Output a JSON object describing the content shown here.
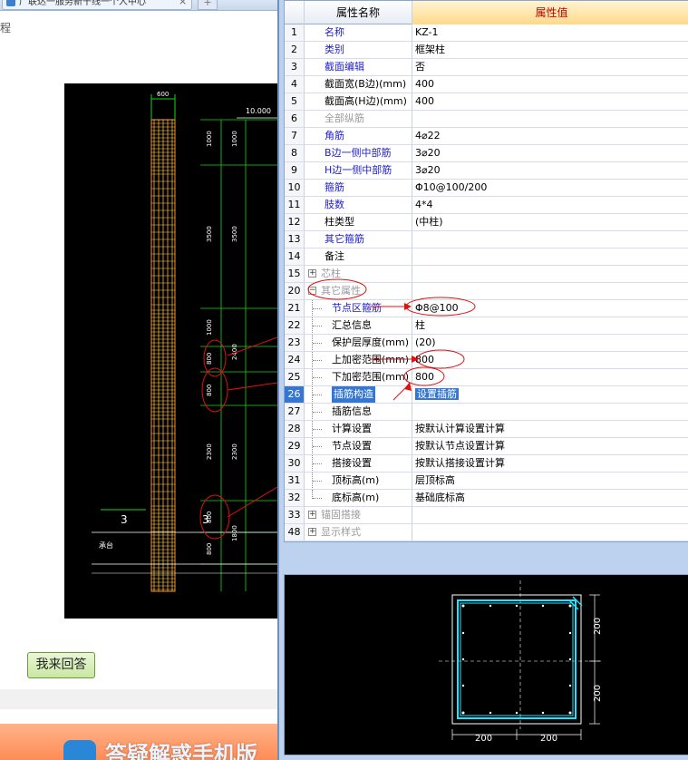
{
  "browser": {
    "tab_title": "广联达一服务新干线一个人中心",
    "tab_close": "×",
    "new_tab": "+",
    "side_char": "程"
  },
  "cad_elevation": {
    "labels": {
      "top_width": "600",
      "elevation_top": "10.000",
      "segs_left": [
        "1000",
        "3500",
        "1000",
        "800",
        "800",
        "2300",
        "800",
        "800"
      ],
      "segs_right": [
        "1000",
        "3500",
        "2400",
        "2300",
        "1800"
      ],
      "section_left": "3",
      "section_right": "3",
      "cheng_tai": "承台"
    }
  },
  "answer_button": {
    "label": "我来回答"
  },
  "promo": {
    "text": "答疑解惑手机版"
  },
  "property_grid": {
    "header": {
      "name": "属性名称",
      "value": "属性值"
    },
    "rows": [
      {
        "num": "1",
        "name": "名称",
        "value": "KZ-1",
        "color": "blue"
      },
      {
        "num": "2",
        "name": "类别",
        "value": "框架柱",
        "color": "blue"
      },
      {
        "num": "3",
        "name": "截面编辑",
        "value": "否",
        "color": "blue"
      },
      {
        "num": "4",
        "name": "截面宽(B边)(mm)",
        "value": "400",
        "color": "black"
      },
      {
        "num": "5",
        "name": "截面高(H边)(mm)",
        "value": "400",
        "color": "black"
      },
      {
        "num": "6",
        "name": "全部纵筋",
        "value": "",
        "color": "gray"
      },
      {
        "num": "7",
        "name": "角筋",
        "value": "4⌀22",
        "color": "blue"
      },
      {
        "num": "8",
        "name": "B边一侧中部筋",
        "value": "3⌀20",
        "color": "blue"
      },
      {
        "num": "9",
        "name": "H边一侧中部筋",
        "value": "3⌀20",
        "color": "blue"
      },
      {
        "num": "10",
        "name": "箍筋",
        "value": "Φ10@100/200",
        "color": "blue"
      },
      {
        "num": "11",
        "name": "肢数",
        "value": "4*4",
        "color": "blue"
      },
      {
        "num": "12",
        "name": "柱类型",
        "value": "(中柱)",
        "color": "black"
      },
      {
        "num": "13",
        "name": "其它箍筋",
        "value": "",
        "color": "blue"
      },
      {
        "num": "14",
        "name": "备注",
        "value": "",
        "color": "black"
      },
      {
        "num": "15",
        "name": "芯柱",
        "value": "",
        "color": "gray",
        "expander": "+"
      },
      {
        "num": "20",
        "name": "其它属性",
        "value": "",
        "color": "gray",
        "expander": "−"
      },
      {
        "num": "21",
        "name": "节点区箍筋",
        "value": "Φ8@100",
        "color": "blue",
        "child": true
      },
      {
        "num": "22",
        "name": "汇总信息",
        "value": "柱",
        "color": "black",
        "child": true
      },
      {
        "num": "23",
        "name": "保护层厚度(mm)",
        "value": "(20)",
        "color": "black",
        "child": true
      },
      {
        "num": "24",
        "name": "上加密范围(mm)",
        "value": "800",
        "color": "black",
        "child": true
      },
      {
        "num": "25",
        "name": "下加密范围(mm)",
        "value": "800",
        "color": "black",
        "child": true
      },
      {
        "num": "26",
        "name": "插筋构造",
        "value": "设置插筋",
        "color": "black",
        "child": true,
        "selected": true
      },
      {
        "num": "27",
        "name": "插筋信息",
        "value": "",
        "color": "black",
        "child": true
      },
      {
        "num": "28",
        "name": "计算设置",
        "value": "按默认计算设置计算",
        "color": "black",
        "child": true
      },
      {
        "num": "29",
        "name": "节点设置",
        "value": "按默认节点设置计算",
        "color": "black",
        "child": true
      },
      {
        "num": "30",
        "name": "搭接设置",
        "value": "按默认搭接设置计算",
        "color": "black",
        "child": true
      },
      {
        "num": "31",
        "name": "顶标高(m)",
        "value": "层顶标高",
        "color": "black",
        "child": true
      },
      {
        "num": "32",
        "name": "底标高(m)",
        "value": "基础底标高",
        "color": "black",
        "child": true,
        "last": true
      },
      {
        "num": "33",
        "name": "锚固搭接",
        "value": "",
        "color": "gray",
        "expander": "+"
      },
      {
        "num": "48",
        "name": "显示样式",
        "value": "",
        "color": "gray",
        "expander": "+"
      }
    ]
  },
  "section_preview": {
    "dim_right_top": "200",
    "dim_right_bottom": "200",
    "dim_bottom_left": "200",
    "dim_bottom_right": "200"
  }
}
